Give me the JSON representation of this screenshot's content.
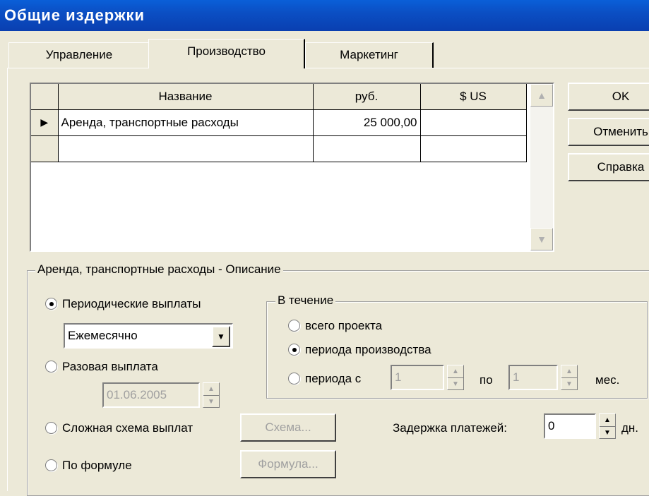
{
  "window": {
    "title": "Общие издержки"
  },
  "tabs": [
    {
      "label": "Управление"
    },
    {
      "label": "Производство"
    },
    {
      "label": "Маркетинг"
    }
  ],
  "grid": {
    "columns": [
      "Название",
      "руб.",
      "$ US"
    ],
    "rows": [
      {
        "name": "Аренда, транспортные расходы",
        "rub": "25 000,00",
        "usd": ""
      },
      {
        "name": "",
        "rub": "",
        "usd": ""
      }
    ]
  },
  "buttons": {
    "ok": "OK",
    "cancel": "Отменить",
    "help": "Справка",
    "scheme": "Схема...",
    "formula": "Формула..."
  },
  "description": {
    "group_label": "Аренда, транспортные расходы - Описание",
    "periodic": "Периодические выплаты",
    "frequency": "Ежемесячно",
    "one_time": "Разовая выплата",
    "one_time_date": "01.06.2005",
    "complex": "Сложная схема выплат",
    "by_formula": "По формуле",
    "selected": "periodic"
  },
  "during": {
    "group_label": "В течение",
    "whole": "всего проекта",
    "production": "периода производства",
    "from": "периода с",
    "from_value": "1",
    "to_label": "по",
    "to_value": "1",
    "unit": "мес.",
    "selected": "production"
  },
  "delay": {
    "label": "Задержка платежей:",
    "value": "0",
    "unit": "дн."
  }
}
